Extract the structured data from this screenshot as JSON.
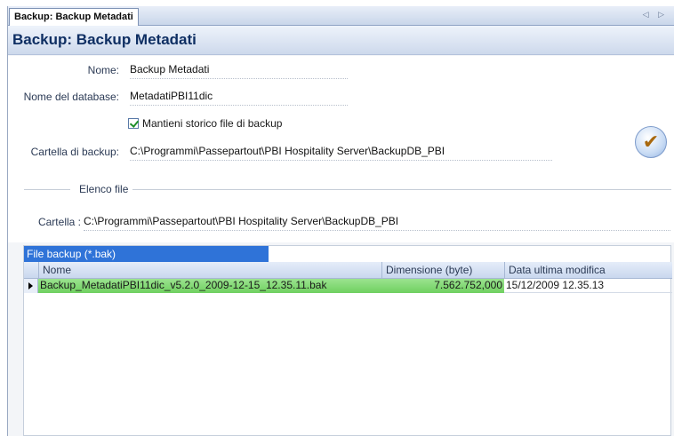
{
  "tab": {
    "label": "Backup: Backup Metadati",
    "nav": "◁ ▷"
  },
  "header": {
    "title": "Backup: Backup Metadati"
  },
  "form": {
    "name_label": "Nome:",
    "name_value": "Backup Metadati",
    "db_label": "Nome del database:",
    "db_value": "MetadatiPBI11dic",
    "keep_history_label": "Mantieni storico file di backup",
    "keep_history_checked": true,
    "folder_label": "Cartella di backup:",
    "folder_value": "C:\\Programmi\\Passepartout\\PBI  Hospitality Server\\BackupDB_PBI",
    "confirm_symbol": "✔"
  },
  "file_list": {
    "section_title": "Elenco file",
    "folder_label": "Cartella :",
    "folder_value": "C:\\Programmi\\Passepartout\\PBI  Hospitality Server\\BackupDB_PBI"
  },
  "grid": {
    "caption": "File backup (*.bak)",
    "columns": [
      "Nome",
      "Dimensione (byte)",
      "Data ultima modifica"
    ],
    "rows": [
      {
        "name": "Backup_MetadatiPBI11dic_v5.2.0_2009-12-15_12.35.11.bak",
        "size": "7.562.752,000",
        "date": "15/12/2009 12.35.13"
      }
    ]
  }
}
